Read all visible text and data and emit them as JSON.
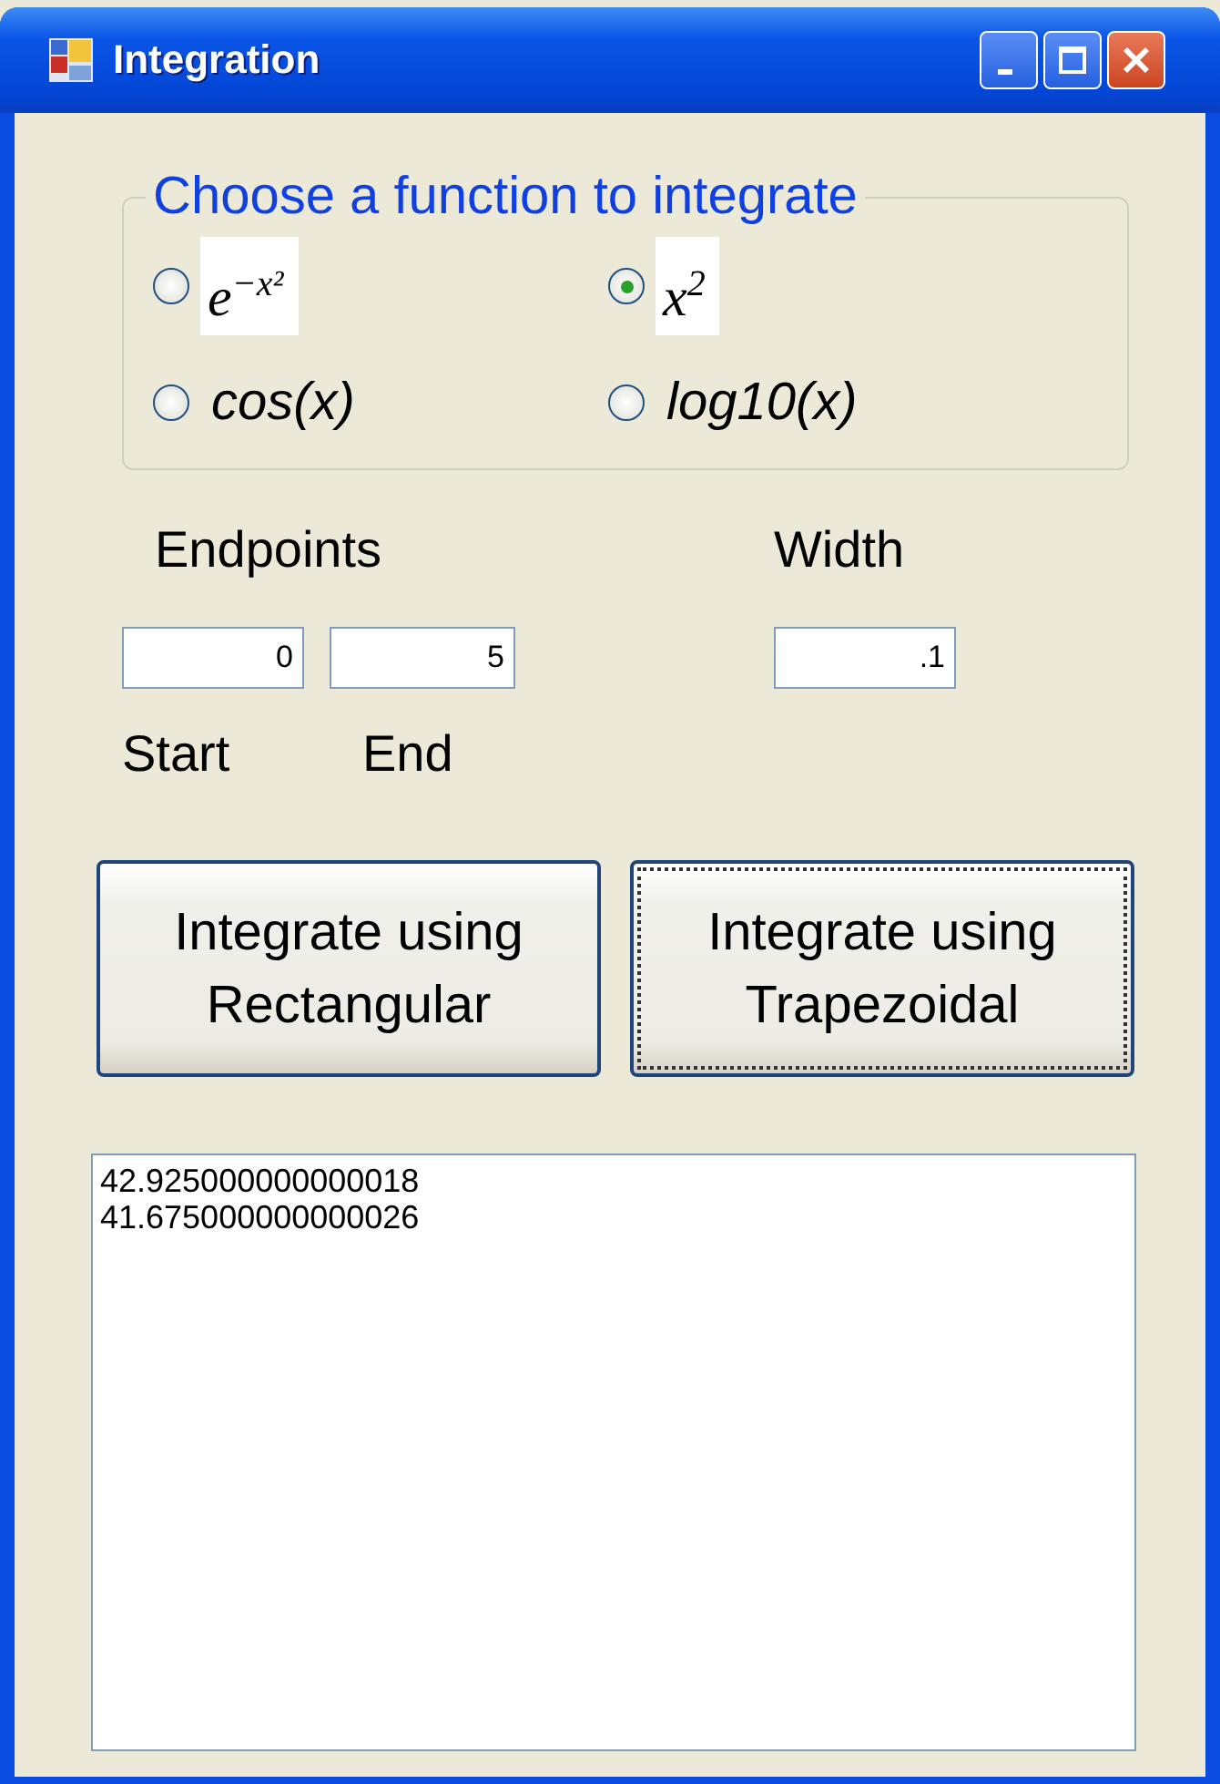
{
  "window": {
    "title": "Integration"
  },
  "function_group": {
    "title": "Choose a function to integrate",
    "options": [
      {
        "label": "e$^{−x²}$",
        "kind": "formula",
        "selected": false
      },
      {
        "label": "x$^{2}$",
        "kind": "formula",
        "selected": true
      },
      {
        "label": "cos(x)",
        "kind": "text",
        "selected": false
      },
      {
        "label": "log10(x)",
        "kind": "text",
        "selected": false
      }
    ]
  },
  "endpoints": {
    "label": "Endpoints",
    "start": {
      "value": "0",
      "label": "Start"
    },
    "end": {
      "value": "5",
      "label": "End"
    }
  },
  "width": {
    "label": "Width",
    "value": ".1"
  },
  "buttons": [
    {
      "label": "Integrate using\nRectangular",
      "focused": false
    },
    {
      "label": "Integrate using\nTrapezoidal",
      "focused": true
    }
  ],
  "results": [
    "42.925000000000018",
    "41.675000000000026"
  ]
}
